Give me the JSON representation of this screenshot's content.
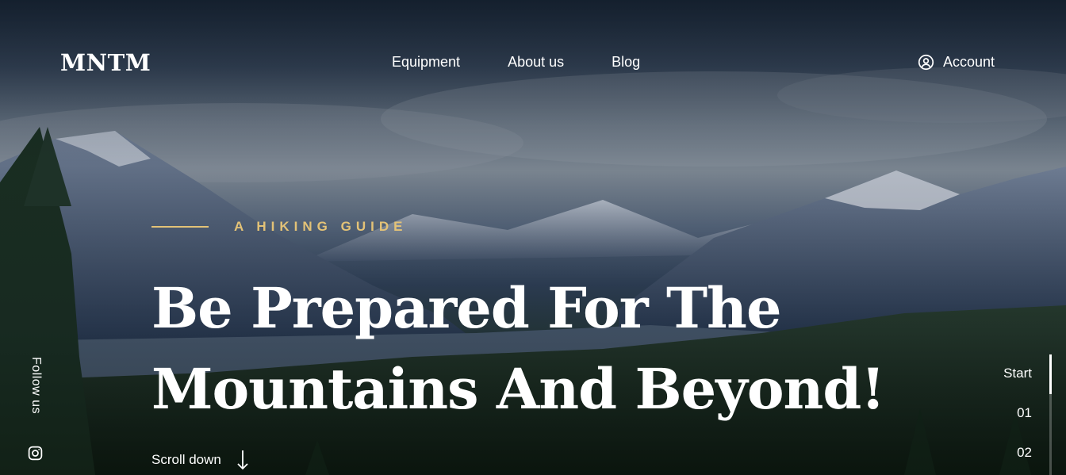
{
  "brand": {
    "logo": "MNTM"
  },
  "nav": {
    "items": [
      "Equipment",
      "About us",
      "Blog"
    ]
  },
  "account": {
    "label": "Account",
    "icon": "user-circle-icon"
  },
  "hero": {
    "eyebrow": "A HIKING GUIDE",
    "headline_line1": "Be Prepared For The",
    "headline_line2": "Mountains And Beyond!",
    "scroll_label": "Scroll down",
    "scroll_icon": "arrow-down-icon"
  },
  "social": {
    "label": "Follow us",
    "icon": "instagram-icon"
  },
  "slides": {
    "items": [
      "Start",
      "01",
      "02"
    ],
    "active": "Start"
  },
  "colors": {
    "accent": "#e3c277",
    "text": "#ffffff"
  }
}
